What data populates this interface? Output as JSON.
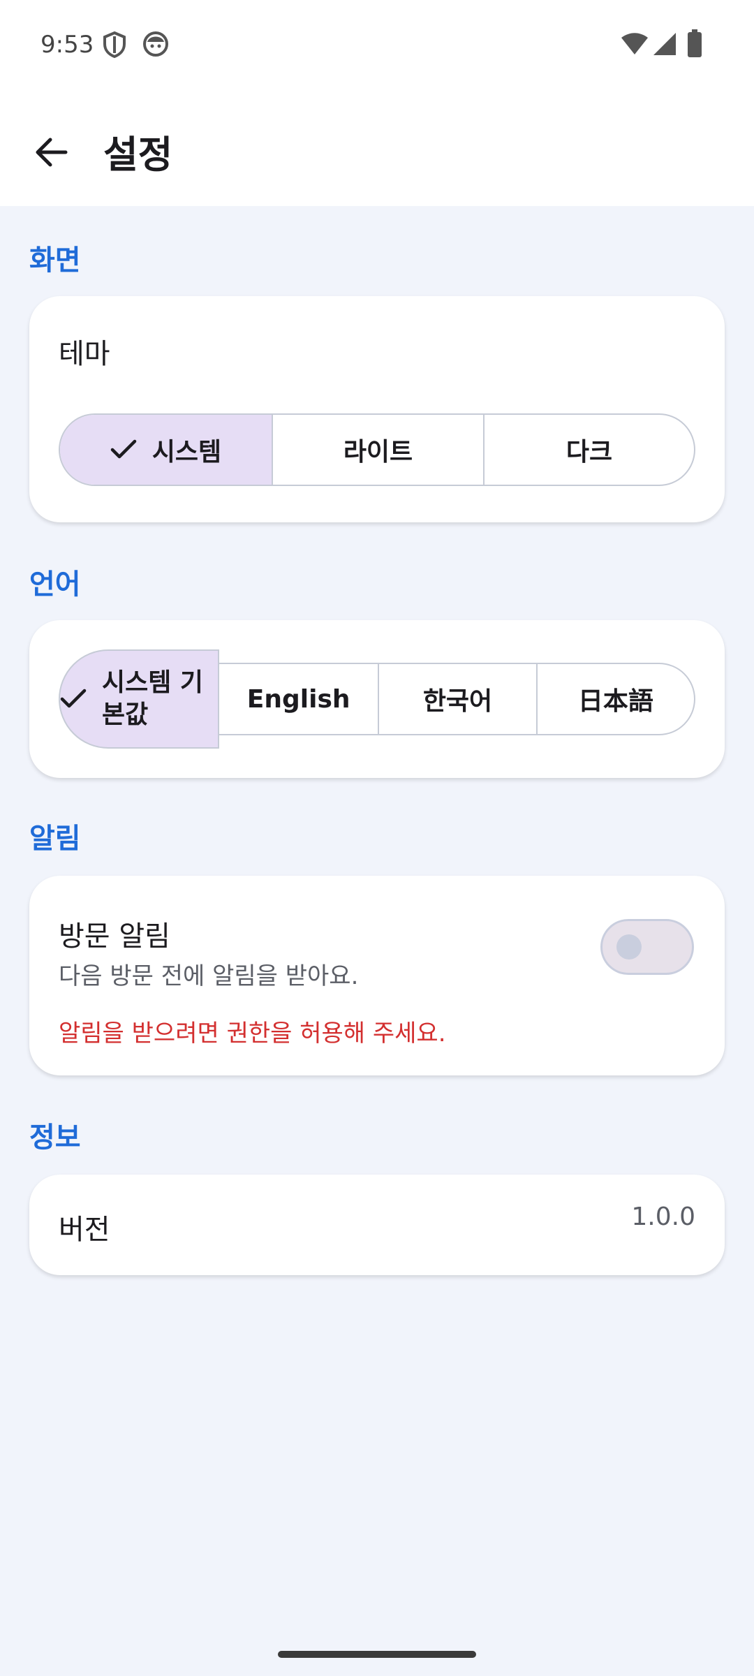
{
  "status_bar": {
    "time": "9:53",
    "left_icons": [
      "shield-icon",
      "face-icon"
    ],
    "right_icons": [
      "wifi-icon",
      "cellular-icon",
      "battery-icon"
    ]
  },
  "app_bar": {
    "title": "설정"
  },
  "sections": {
    "display": {
      "label": "화면",
      "theme_title": "테마",
      "options": [
        "시스템",
        "라이트",
        "다크"
      ],
      "selected": "시스템"
    },
    "language": {
      "label": "언어",
      "options": [
        "시스템 기본값",
        "English",
        "한국어",
        "日本語"
      ],
      "selected_line1": "시스템 기",
      "selected_line2": "본값",
      "selected": "시스템 기본값"
    },
    "notifications": {
      "label": "알림",
      "visit_title": "방문 알림",
      "visit_desc": "다음 방문 전에 알림을 받아요.",
      "permission_warning": "알림을 받으려면 권한을 허용해 주세요.",
      "toggle_on": false
    },
    "info": {
      "label": "정보",
      "version_label": "버전",
      "version_value": "1.0.0"
    }
  },
  "colors": {
    "accent": "#1f6bd8",
    "selected_bg": "#e6ddf5",
    "warning": "#d32f2f",
    "background": "#f1f4fb"
  }
}
